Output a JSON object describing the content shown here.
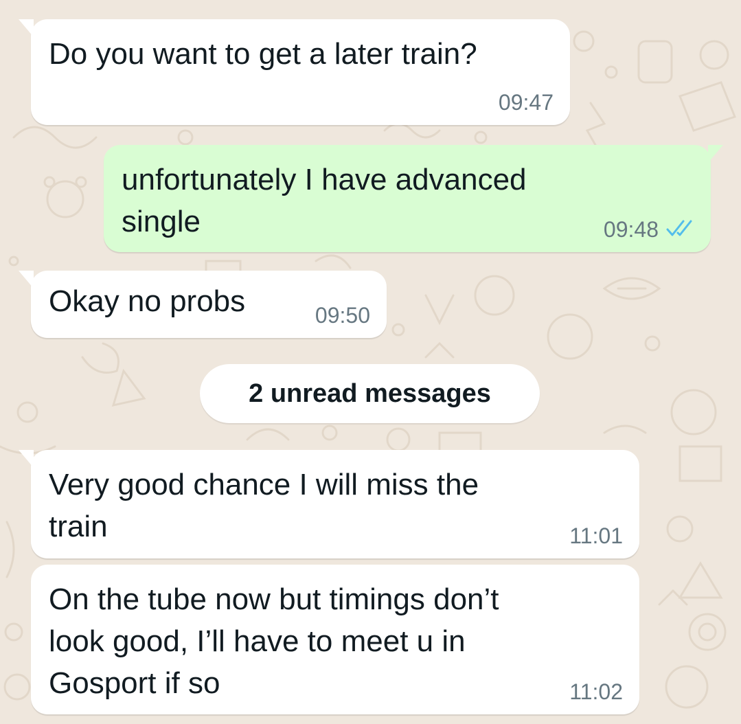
{
  "messages": [
    {
      "direction": "incoming",
      "text": "Do you want to get a later train?",
      "time": "09:47"
    },
    {
      "direction": "outgoing",
      "text": "unfortunately I have advanced\nsingle",
      "time": "09:48",
      "status": "read-double-tick-icon"
    },
    {
      "direction": "incoming",
      "text": "Okay no probs",
      "time": "09:50"
    },
    {
      "direction": "incoming",
      "text": "Very good chance I will miss the\ntrain",
      "time": "11:01"
    },
    {
      "direction": "incoming",
      "text": "On the tube now but timings don’t\nlook good, I’ll have to meet u in\nGosport if so",
      "time": "11:02"
    }
  ],
  "unread_divider": {
    "label": "2 unread messages"
  },
  "colors": {
    "background": "#efe7dd",
    "incoming_bubble": "#ffffff",
    "outgoing_bubble": "#d9fdd3",
    "text": "#111b21",
    "timestamp": "#667781",
    "read_ticks": "#53bdeb"
  }
}
